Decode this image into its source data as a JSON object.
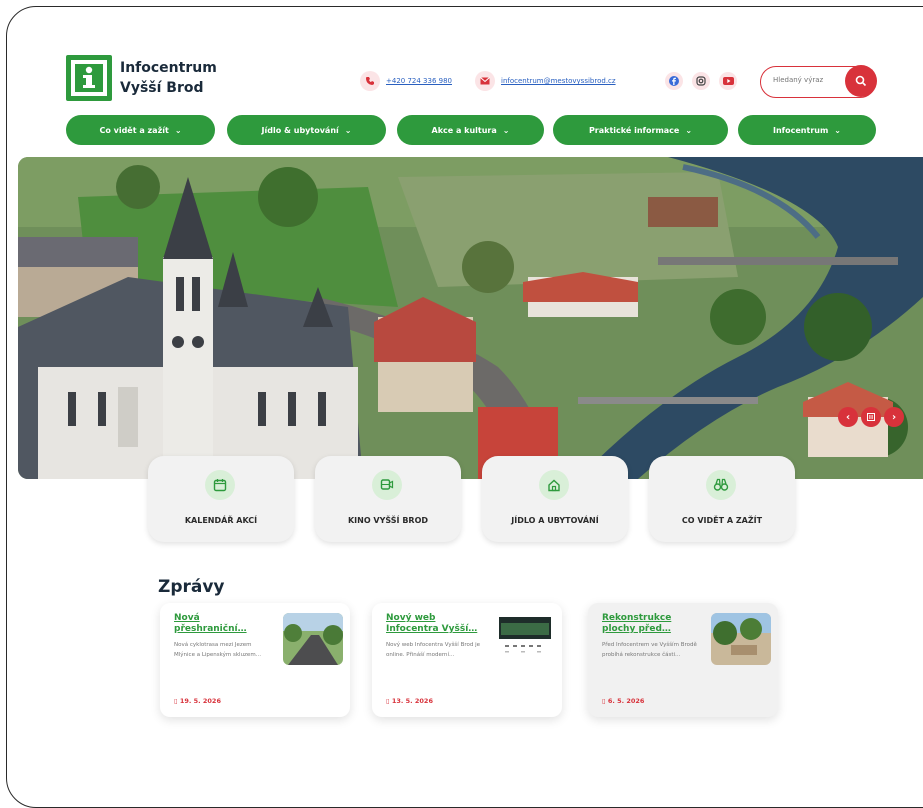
{
  "header": {
    "logo_line1": "Infocentrum",
    "logo_line2": "Vyšší Brod",
    "phone": "+420 724 336 980",
    "email": "infocentrum@mestovyssibrod.cz",
    "search_placeholder": "Hledaný výraz"
  },
  "nav": [
    {
      "label": "Co vidět a zažít"
    },
    {
      "label": "Jídlo & ubytování"
    },
    {
      "label": "Akce a kultura"
    },
    {
      "label": "Praktické informace"
    },
    {
      "label": "Infocentrum"
    }
  ],
  "quick_links": [
    {
      "label": "KALENDÁŘ AKCÍ",
      "icon": "calendar-icon"
    },
    {
      "label": "KINO VYŠŠÍ BROD",
      "icon": "cinema-icon"
    },
    {
      "label": "JÍDLO A UBYTOVÁNÍ",
      "icon": "home-icon"
    },
    {
      "label": "CO VIDĚT A ZAŽÍT",
      "icon": "binoculars-icon"
    }
  ],
  "news": {
    "title": "Zprávy",
    "items": [
      {
        "title": "Nová přeshraniční…",
        "text": "Nová cyklotrasa mezi Jezem Mlýnice a Lipenským skluzem…",
        "date": "19. 5. 2026"
      },
      {
        "title": "Nový web Infocentra Vyšší…",
        "text": "Nový web Infocentra Vyšší Brod je online. Přináší moderní…",
        "date": "13. 5. 2026"
      },
      {
        "title": "Rekonstrukce plochy před…",
        "text": "Před Infocentrem ve Vyšším Brodě probíhá rekonstrukce části…",
        "date": "6. 5. 2026"
      }
    ]
  },
  "colors": {
    "green": "#2e9a3d",
    "red": "#d8323b"
  }
}
